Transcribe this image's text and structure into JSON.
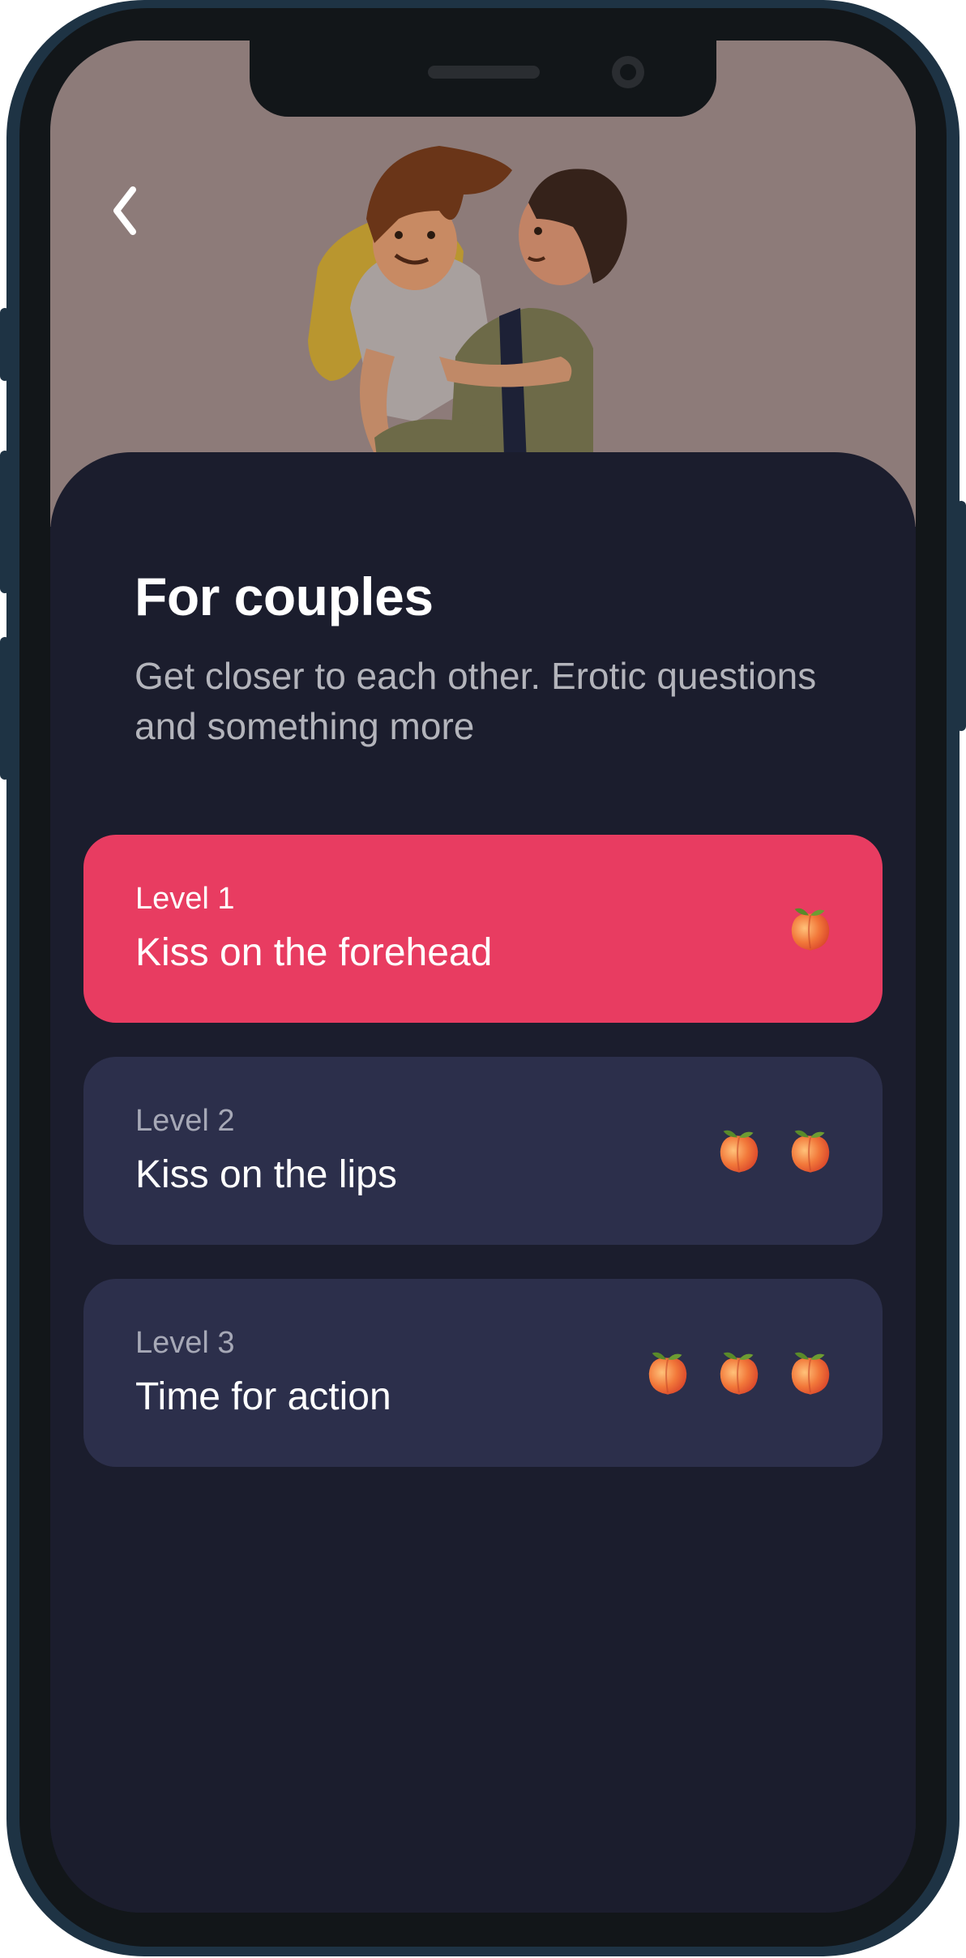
{
  "screen": {
    "title": "For couples",
    "subtitle": "Get closer to each other. Erotic questions and something more"
  },
  "levels": [
    {
      "label": "Level 1",
      "name": "Kiss on the forehead",
      "intensity": 1,
      "selected": true
    },
    {
      "label": "Level 2",
      "name": "Kiss on the lips",
      "intensity": 2,
      "selected": false
    },
    {
      "label": "Level 3",
      "name": "Time for action",
      "intensity": 3,
      "selected": false
    }
  ],
  "icons": {
    "back": "chevron-left-icon",
    "intensity": "peach-icon"
  },
  "colors": {
    "hero_background": "#8d7b79",
    "sheet_background": "#1b1d2d",
    "card_background": "#2c2f4b",
    "selected_card": "#e83c61",
    "frame": "#1e3344"
  }
}
